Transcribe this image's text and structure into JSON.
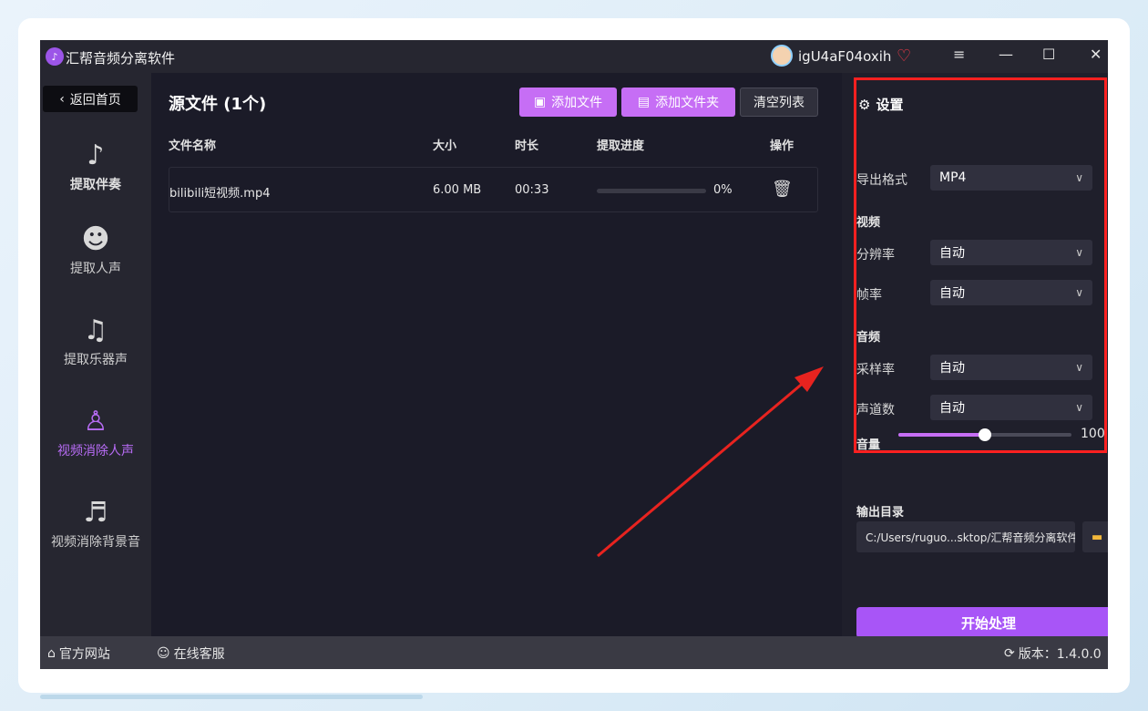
{
  "window": {
    "title": "汇帮音频分离软件",
    "username": "igU4aF04oxih",
    "controls": {
      "menu": "≡",
      "minimize": "—",
      "maximize": "☐",
      "close": "✕"
    }
  },
  "sidebar": {
    "back_label": "返回首页",
    "items": [
      {
        "label": "提取伴奏",
        "icon": "music-note-icon"
      },
      {
        "label": "提取人声",
        "icon": "voice-head-icon"
      },
      {
        "label": "提取乐器声",
        "icon": "guitar-icon"
      },
      {
        "label": "视频消除人声",
        "icon": "user-remove-icon"
      },
      {
        "label": "视频消除背景音",
        "icon": "music-off-icon"
      }
    ]
  },
  "main": {
    "title": "源文件 (1个)",
    "buttons": {
      "add_file": "添加文件",
      "add_folder": "添加文件夹",
      "clear_list": "清空列表"
    },
    "columns": [
      "文件名称",
      "大小",
      "时长",
      "提取进度",
      "操作"
    ],
    "files": [
      {
        "name": "bilibili短视频.mp4",
        "size": "6.00 MB",
        "duration": "00:33",
        "progress_text": "0%",
        "progress": 0
      }
    ]
  },
  "settings": {
    "title": "设置",
    "export_format_label": "导出格式",
    "export_format_value": "MP4",
    "video_section": "视频",
    "resolution_label": "分辨率",
    "resolution_value": "自动",
    "framerate_label": "帧率",
    "framerate_value": "自动",
    "audio_section": "音频",
    "samplerate_label": "采样率",
    "samplerate_value": "自动",
    "channels_label": "声道数",
    "channels_value": "自动",
    "volume_label": "音量",
    "volume_value": "100",
    "volume_fraction": 0.5,
    "output_dir_label": "输出目录",
    "output_dir_value": "C:/Users/ruguo...sktop/汇帮音频分离软件",
    "start_button": "开始处理"
  },
  "footer": {
    "website": "官方网站",
    "support": "在线客服",
    "version": "版本：1.4.0.0"
  },
  "colors": {
    "accent": "#c66ef5",
    "start_button": "#a855f7",
    "highlight_box": "#ff2020",
    "annotation_arrow": "#e8231f"
  }
}
